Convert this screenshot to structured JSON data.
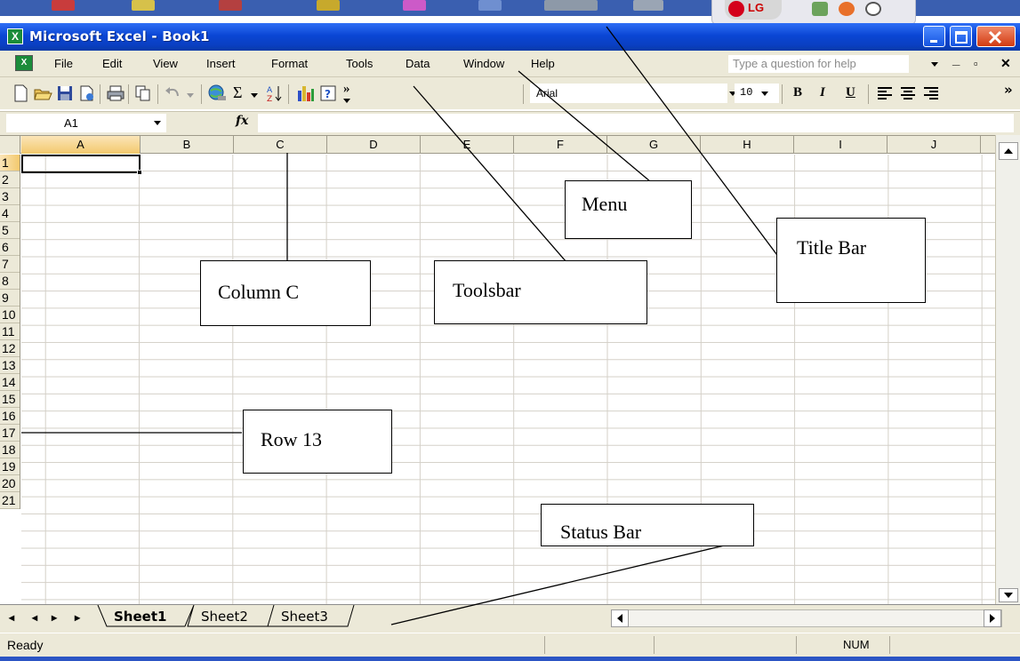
{
  "window": {
    "title": "Microsoft Excel - Book1",
    "app_icon": "excel-icon",
    "controls": [
      "minimize-icon",
      "maximize-icon",
      "close-icon"
    ]
  },
  "tray": {
    "lg_label": "LG"
  },
  "menu": {
    "items": [
      {
        "label": "File"
      },
      {
        "label": "Edit"
      },
      {
        "label": "View"
      },
      {
        "label": "Insert"
      },
      {
        "label": "Format"
      },
      {
        "label": "Tools"
      },
      {
        "label": "Data"
      },
      {
        "label": "Window"
      },
      {
        "label": "Help"
      }
    ],
    "help_placeholder": "Type a question for help"
  },
  "toolbar": {
    "icons": [
      "new-icon",
      "open-icon",
      "save-icon",
      "permission-icon",
      "print-icon",
      "copy-icon",
      "undo-icon",
      "hyperlink-icon",
      "autosum-icon",
      "sort-ascending-icon",
      "chart-wizard-icon",
      "help-icon",
      "more-buttons-icon"
    ],
    "font_name": "Arial",
    "font_size": "10",
    "bold": "B",
    "italic": "I",
    "underline": "U",
    "sigma": "Σ",
    "more": "»"
  },
  "formula_bar": {
    "name_box": "A1",
    "fx_label": "fx",
    "formula": ""
  },
  "grid": {
    "columns": [
      "A",
      "B",
      "C",
      "D",
      "E",
      "F",
      "G",
      "H",
      "I",
      "J"
    ],
    "rows": [
      "1",
      "2",
      "3",
      "4",
      "5",
      "6",
      "7",
      "8",
      "9",
      "10",
      "11",
      "12",
      "13",
      "14",
      "15",
      "16",
      "17",
      "18",
      "19",
      "20",
      "21"
    ],
    "active_cell": "A1"
  },
  "sheets": {
    "tabs": [
      {
        "label": "Sheet1",
        "active": true
      },
      {
        "label": "Sheet2",
        "active": false
      },
      {
        "label": "Sheet3",
        "active": false
      }
    ]
  },
  "status_bar": {
    "status": "Ready",
    "num_lock": "NUM"
  },
  "annotations": {
    "menu": "Menu",
    "title_bar": "Title Bar",
    "column_c": "Column C",
    "toolsbar": "Toolsbar",
    "row_13": "Row 13",
    "status_bar": "Status Bar"
  }
}
